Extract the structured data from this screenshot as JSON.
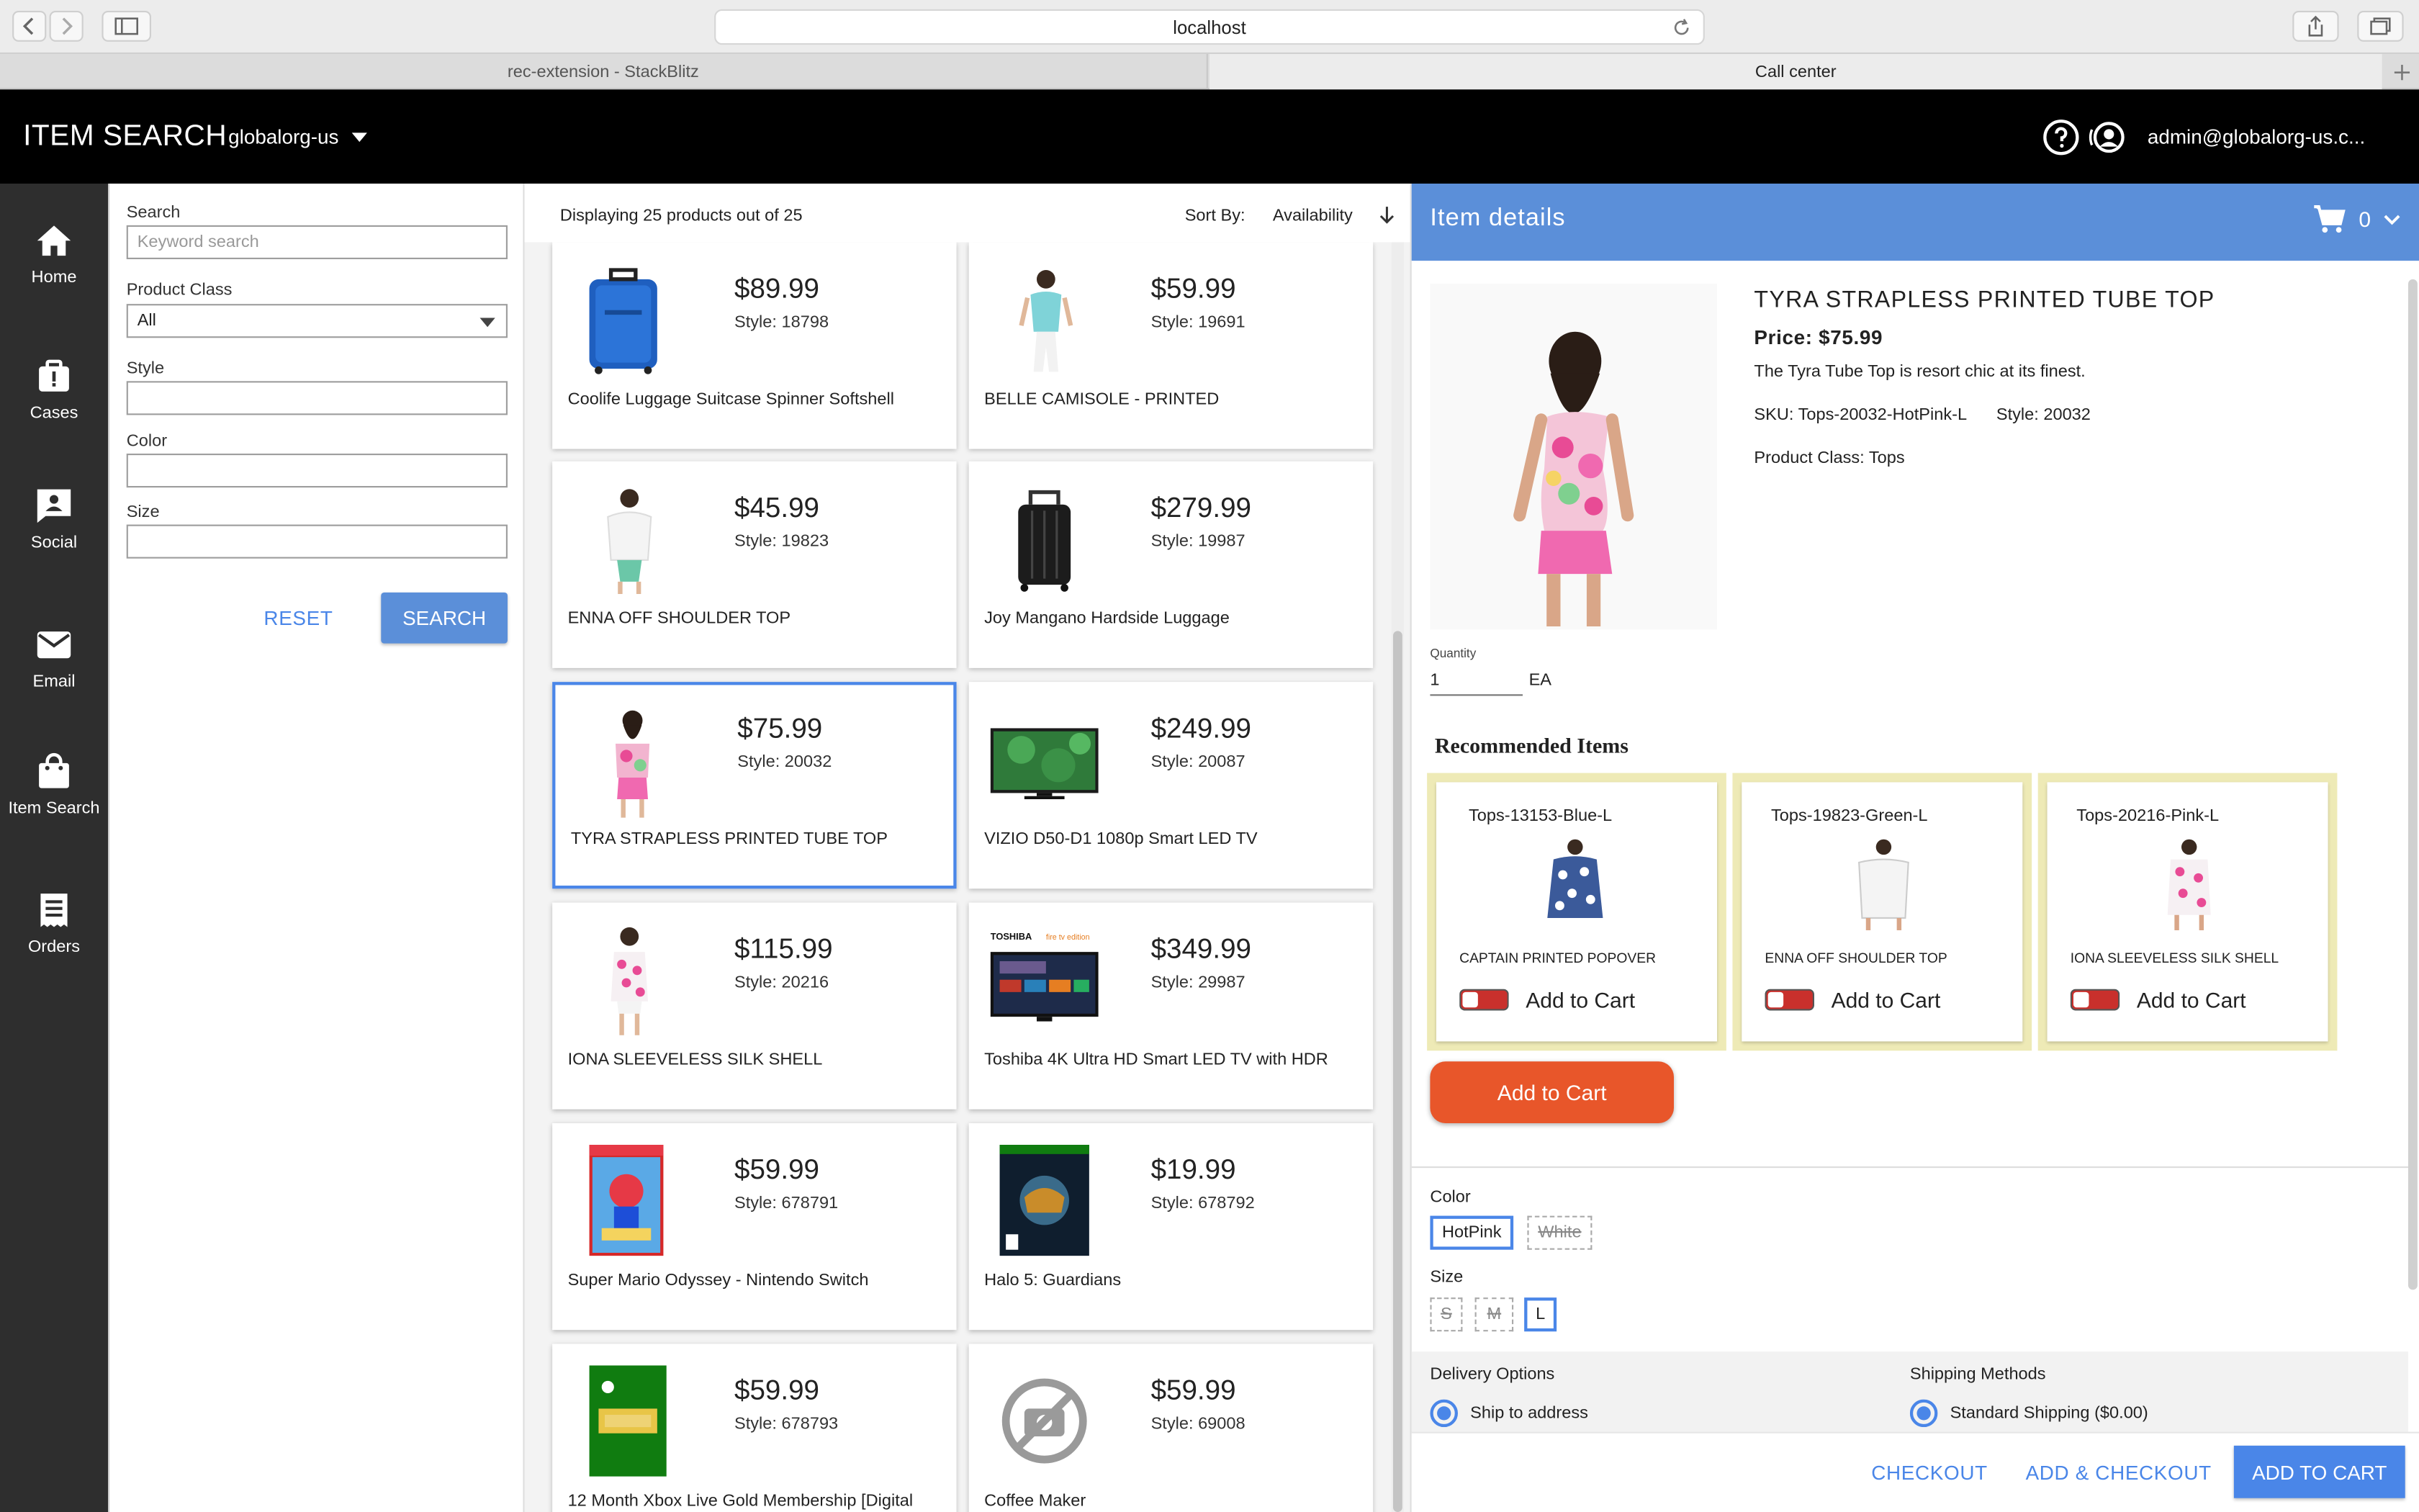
{
  "browser": {
    "url": "localhost",
    "tabs": [
      {
        "label": "rec-extension - StackBlitz"
      },
      {
        "label": "Call center"
      }
    ]
  },
  "header": {
    "title": "ITEM SEARCH",
    "org": "globalorg-us",
    "user": "admin@globalorg-us.c..."
  },
  "sidebar": {
    "items": [
      {
        "label": "Home",
        "icon": "home-icon"
      },
      {
        "label": "Cases",
        "icon": "cases-icon"
      },
      {
        "label": "Social",
        "icon": "social-icon"
      },
      {
        "label": "Email",
        "icon": "email-icon"
      },
      {
        "label": "Item Search",
        "icon": "shopping-bag-icon"
      },
      {
        "label": "Orders",
        "icon": "orders-icon"
      }
    ]
  },
  "search_form": {
    "search_label": "Search",
    "search_placeholder": "Keyword search",
    "product_class_label": "Product Class",
    "product_class_value": "All",
    "style_label": "Style",
    "color_label": "Color",
    "size_label": "Size",
    "reset_label": "RESET",
    "search_button": "SEARCH"
  },
  "results": {
    "count_text": "Displaying 25 products out of 25",
    "sort_label": "Sort By:",
    "sort_value": "Availability",
    "products": [
      {
        "price": "$89.99",
        "style": "Style: 18798",
        "name": "Coolife Luggage Suitcase Spinner Softshell",
        "img": "suitcase-blue"
      },
      {
        "price": "$59.99",
        "style": "Style: 19691",
        "name": "BELLE CAMISOLE - PRINTED",
        "img": "camisole"
      },
      {
        "price": "$45.99",
        "style": "Style: 19823",
        "name": "ENNA OFF SHOULDER TOP",
        "img": "white-top"
      },
      {
        "price": "$279.99",
        "style": "Style: 19987",
        "name": "Joy Mangano Hardside Luggage",
        "img": "suitcase-black"
      },
      {
        "price": "$75.99",
        "style": "Style: 20032",
        "name": "TYRA STRAPLESS PRINTED TUBE TOP",
        "img": "tube-top"
      },
      {
        "price": "$249.99",
        "style": "Style: 20087",
        "name": "VIZIO D50-D1 1080p Smart LED TV",
        "img": "tv-vizio"
      },
      {
        "price": "$115.99",
        "style": "Style: 20216",
        "name": "IONA SLEEVELESS SILK SHELL",
        "img": "silk-shell"
      },
      {
        "price": "$349.99",
        "style": "Style: 29987",
        "name": "Toshiba 4K Ultra HD Smart LED TV with HDR",
        "img": "tv-toshiba"
      },
      {
        "price": "$59.99",
        "style": "Style: 678791",
        "name": "Super Mario Odyssey - Nintendo Switch",
        "img": "game-mario"
      },
      {
        "price": "$19.99",
        "style": "Style: 678792",
        "name": "Halo 5: Guardians",
        "img": "game-halo"
      },
      {
        "price": "$59.99",
        "style": "Style: 678793",
        "name": "12 Month Xbox Live Gold Membership [Digital",
        "img": "xbox-gold"
      },
      {
        "price": "$59.99",
        "style": "Style: 69008",
        "name": "Coffee Maker",
        "img": "no-image"
      }
    ]
  },
  "details": {
    "panel_title": "Item details",
    "cart_count": "0",
    "product_title": "TYRA STRAPLESS PRINTED TUBE TOP",
    "price": "Price: $75.99",
    "description": "The Tyra Tube Top is resort chic at its finest.",
    "sku": "SKU: Tops-20032-HotPink-L",
    "style": "Style: 20032",
    "product_class": "Product Class: Tops",
    "quantity_label": "Quantity",
    "quantity_value": "1",
    "unit": "EA",
    "recommended_title": "Recommended Items",
    "recommended": [
      {
        "sku": "Tops-13153-Blue-L",
        "name": "CAPTAIN PRINTED POPOVER",
        "add_label": "Add to Cart"
      },
      {
        "sku": "Tops-19823-Green-L",
        "name": "ENNA OFF SHOULDER TOP",
        "add_label": "Add to Cart"
      },
      {
        "sku": "Tops-20216-Pink-L",
        "name": "IONA SLEEVELESS SILK SHELL",
        "add_label": "Add to Cart"
      }
    ],
    "add_to_cart_label": "Add to Cart",
    "color_label": "Color",
    "colors": [
      "HotPink",
      "White"
    ],
    "selected_color": "HotPink",
    "size_label": "Size",
    "sizes": [
      "S",
      "M",
      "L"
    ],
    "selected_size": "L",
    "delivery_label": "Delivery Options",
    "delivery_value": "Ship to address",
    "shipping_label": "Shipping Methods",
    "shipping_value": "Standard Shipping ($0.00)",
    "checkout_label": "CHECKOUT",
    "add_checkout_label": "ADD & CHECKOUT",
    "add_to_cart_footer": "ADD TO CART"
  },
  "colors": {
    "header_bg": "#000000",
    "sidebar_bg": "#2e2e2e",
    "accent": "#4a86e8",
    "detail_header": "#5b8fd9",
    "add_to_cart_btn": "#e8562a",
    "rec_card_bg": "#eeeab6"
  }
}
